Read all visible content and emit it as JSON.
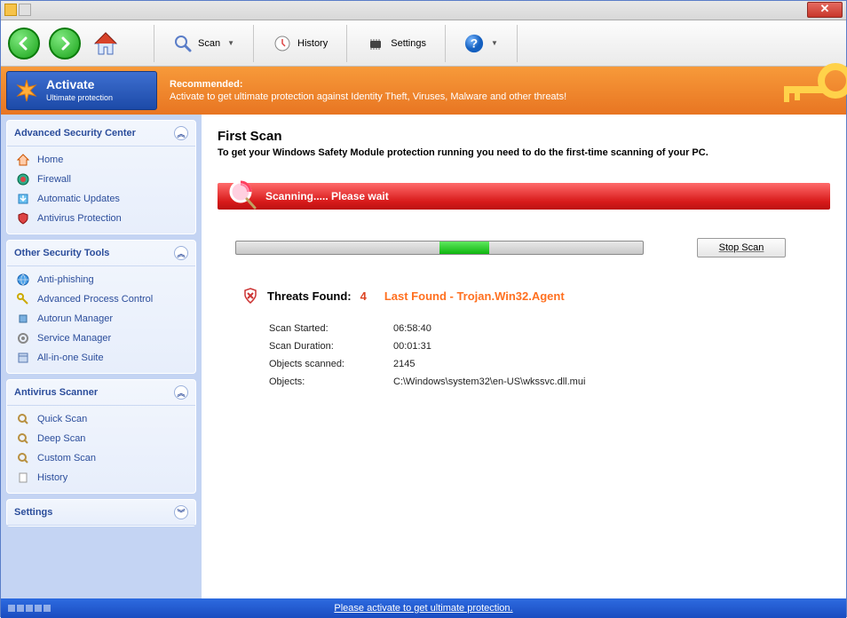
{
  "toolbar": {
    "scan": "Scan",
    "history": "History",
    "settings": "Settings"
  },
  "promo": {
    "activate_title": "Activate",
    "activate_sub": "Ultimate protection",
    "recommended": "Recommended:",
    "line": "Activate                          to get ultimate protection against Identity Theft, Viruses, Malware and other threats!"
  },
  "sidebar": {
    "panel1": {
      "title": "Advanced Security Center",
      "items": [
        "Home",
        "Firewall",
        "Automatic Updates",
        "Antivirus Protection"
      ]
    },
    "panel2": {
      "title": "Other Security Tools",
      "items": [
        "Anti-phishing",
        "Advanced Process Control",
        "Autorun Manager",
        "Service Manager",
        "All-in-one Suite"
      ]
    },
    "panel3": {
      "title": "Antivirus Scanner",
      "items": [
        "Quick Scan",
        "Deep Scan",
        "Custom Scan",
        "History"
      ]
    },
    "panel4": {
      "title": "Settings"
    }
  },
  "main": {
    "heading": "First Scan",
    "subheading": "To get your Windows Safety Module protection running you need to do the first-time scanning of your PC.",
    "scanning": "Scanning..... Please wait",
    "stop": "Stop Scan",
    "threats_label": "Threats Found:",
    "threats_count": "4",
    "last_found_label": "Last Found - ",
    "last_found_name": "Trojan.Win32.Agent",
    "rows": {
      "started_k": "Scan Started:",
      "started_v": "06:58:40",
      "duration_k": "Scan Duration:",
      "duration_v": "00:01:31",
      "scanned_k": "Objects scanned:",
      "scanned_v": "2145",
      "objects_k": "Objects:",
      "objects_v": "C:\\Windows\\system32\\en-US\\wkssvc.dll.mui"
    }
  },
  "footer": {
    "text": "Please activate to get ultimate protection."
  }
}
